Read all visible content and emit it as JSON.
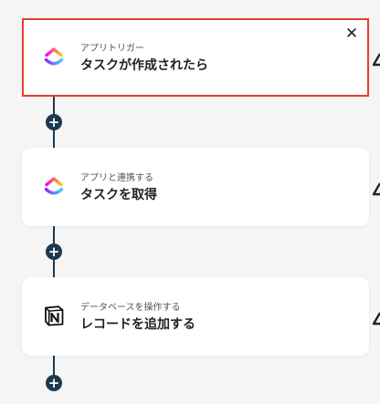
{
  "steps": [
    {
      "kind": "アプリトリガー",
      "title": "タスクが作成されたら",
      "icon": "clickup-icon",
      "selected": true
    },
    {
      "kind": "アプリと連携する",
      "title": "タスクを取得",
      "icon": "clickup-icon",
      "selected": false
    },
    {
      "kind": "データベースを操作する",
      "title": "レコードを追加する",
      "icon": "notion-icon",
      "selected": false
    }
  ],
  "close_glyph": "✕",
  "add_glyph": "+",
  "colors": {
    "selected_border": "#e8412e",
    "connector": "#1c3a4f",
    "background": "#f5f5f5",
    "card": "#ffffff"
  }
}
